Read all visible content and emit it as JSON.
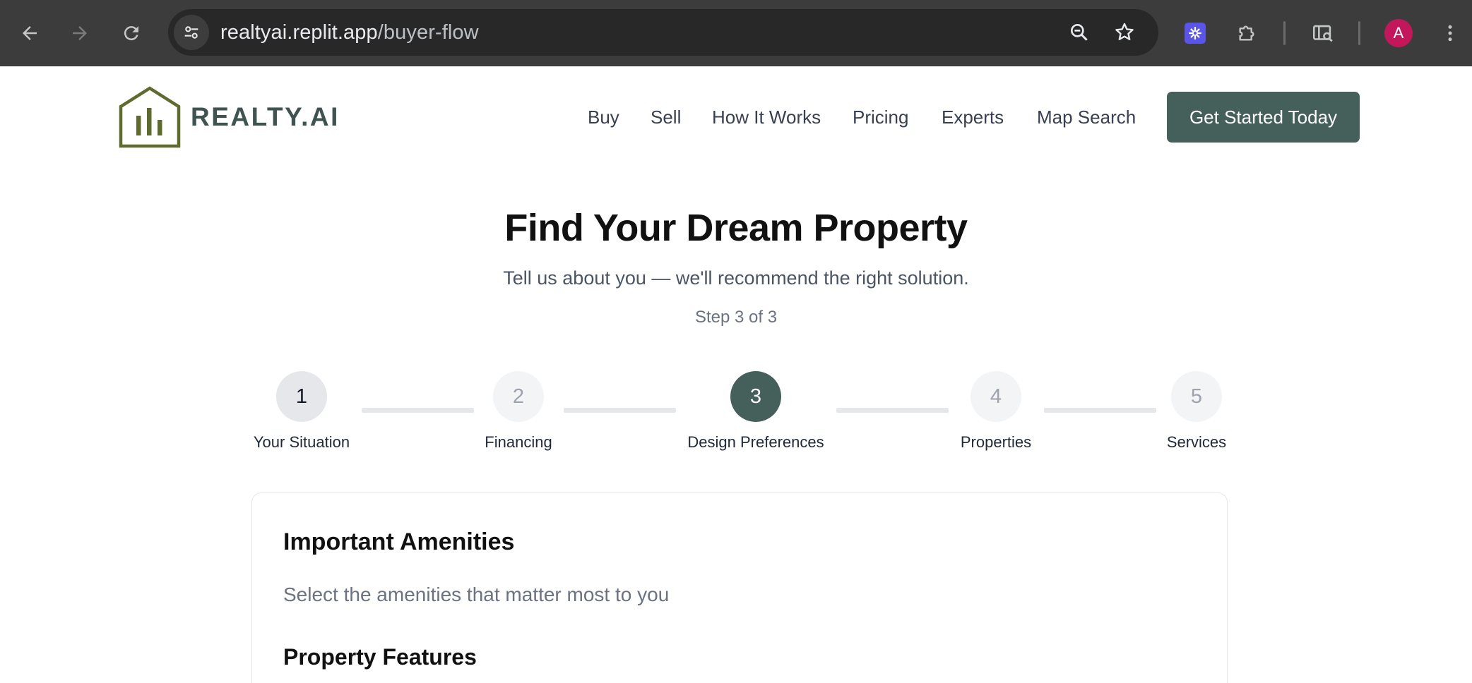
{
  "browser": {
    "url_host": "realtyai.replit.app",
    "url_path": "/buyer-flow",
    "profile_initial": "A",
    "icons": [
      "back-arrow-icon",
      "forward-arrow-icon",
      "reload-icon",
      "site-settings-icon",
      "zoom-icon",
      "bookmark-star-icon",
      "extension-icon",
      "puzzle-icon",
      "cast-search-icon",
      "more-vert-icon"
    ]
  },
  "header": {
    "logo_text": "REALTY.AI",
    "nav": [
      "Buy",
      "Sell",
      "How It Works",
      "Pricing",
      "Experts",
      "Map Search"
    ],
    "cta_label": "Get Started Today",
    "brand_color": "#45605b",
    "logo_color": "#5f6b2e"
  },
  "hero": {
    "title": "Find Your Dream Property",
    "subtitle": "Tell us about you — we'll recommend the right solution.",
    "step_text": "Step 3 of 3"
  },
  "stepper": {
    "steps": [
      {
        "number": "1",
        "label": "Your Situation",
        "state": "done"
      },
      {
        "number": "2",
        "label": "Financing",
        "state": "todo"
      },
      {
        "number": "3",
        "label": "Design Preferences",
        "state": "active"
      },
      {
        "number": "4",
        "label": "Properties",
        "state": "todo"
      },
      {
        "number": "5",
        "label": "Services",
        "state": "todo"
      }
    ]
  },
  "card": {
    "title": "Important Amenities",
    "description": "Select the amenities that matter most to you",
    "section_title": "Property Features"
  }
}
